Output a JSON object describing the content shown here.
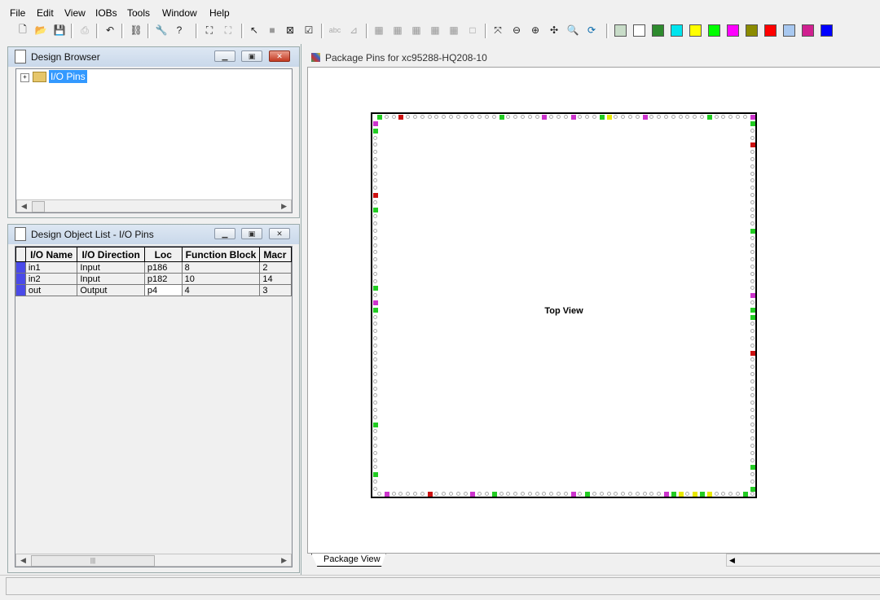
{
  "menu": [
    "File",
    "Edit",
    "View",
    "IOBs",
    "Tools",
    "Window",
    "Help"
  ],
  "toolbar": {
    "icons": [
      "new-file-icon",
      "open-folder-icon",
      "save-icon",
      "print-icon",
      "undo-icon",
      "find-icon",
      "wrench-icon",
      "help-pointer-icon",
      "zoom-box-icon",
      "zoom-box-2-icon",
      "select-arrow-icon",
      "stop-icon",
      "cross-box-icon",
      "check-box-icon",
      "abc-icon",
      "measure-icon",
      "grid-1-icon",
      "grid-2-icon",
      "grid-3-icon",
      "grid-4-icon",
      "grid-5-icon",
      "blank-box-icon",
      "fit-icon",
      "zoom-out-icon",
      "zoom-in-icon",
      "zoom-full-icon",
      "zoom-find-icon",
      "refresh-icon"
    ],
    "swatches": [
      "#c8dcc8",
      "#ffffff",
      "#2e8b2e",
      "#00e5ee",
      "#ffff00",
      "#00ff00",
      "#ff00ff",
      "#8b8b00",
      "#ff0000",
      "#a8c8f0",
      "#d02090",
      "#0000ff"
    ]
  },
  "design_browser": {
    "title": "Design Browser",
    "tree_item": "I/O Pins"
  },
  "object_list": {
    "title": "Design Object List - I/O Pins",
    "columns": [
      "I/O Name",
      "I/O Direction",
      "Loc",
      "Function Block",
      "Macr"
    ],
    "rows": [
      {
        "name": "in1",
        "dir": "Input",
        "loc": "p186",
        "fb": "8",
        "mc": "2"
      },
      {
        "name": "in2",
        "dir": "Input",
        "loc": "p182",
        "fb": "10",
        "mc": "14"
      },
      {
        "name": "out",
        "dir": "Output",
        "loc": "p4",
        "fb": "4",
        "mc": "3"
      }
    ]
  },
  "package_view": {
    "title": "Package Pins for xc95288-HQ208-10",
    "center_label": "Top View",
    "tab_label": "Package View",
    "pin_colors": {
      "green": "#22cc22",
      "magenta": "#cc33cc",
      "red": "#cc1111",
      "yellow": "#e8e800",
      "blue": "#3333cc"
    }
  }
}
